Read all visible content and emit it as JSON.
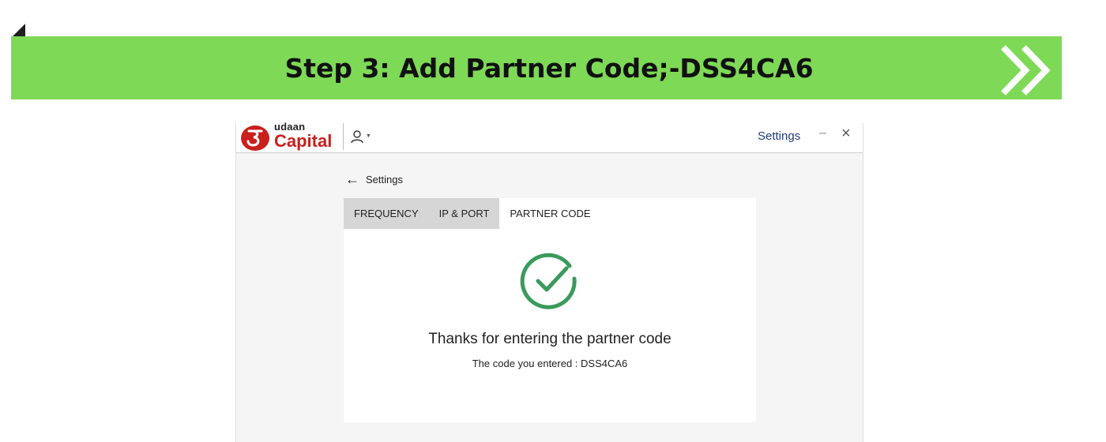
{
  "banner": {
    "title": "Step 3: Add Partner Code;-DSS4CA6",
    "color": "#7ed957"
  },
  "app": {
    "logo_small": "udaan",
    "logo_big": "Capital",
    "brand_color": "#c8201d",
    "user_icon": "user-icon",
    "settings_link": "Settings",
    "minimize_symbol": "–",
    "close_symbol": "×"
  },
  "page": {
    "back_label": "Settings",
    "tabs": [
      {
        "label": "FREQUENCY",
        "active": false
      },
      {
        "label": "IP & PORT",
        "active": false
      },
      {
        "label": "PARTNER CODE",
        "active": true
      }
    ],
    "success_icon": "check-circle-icon",
    "success_color": "#3a9a5c",
    "thanks_message": "Thanks for entering the partner code",
    "entered_message": "The code you entered : DSS4CA6"
  }
}
